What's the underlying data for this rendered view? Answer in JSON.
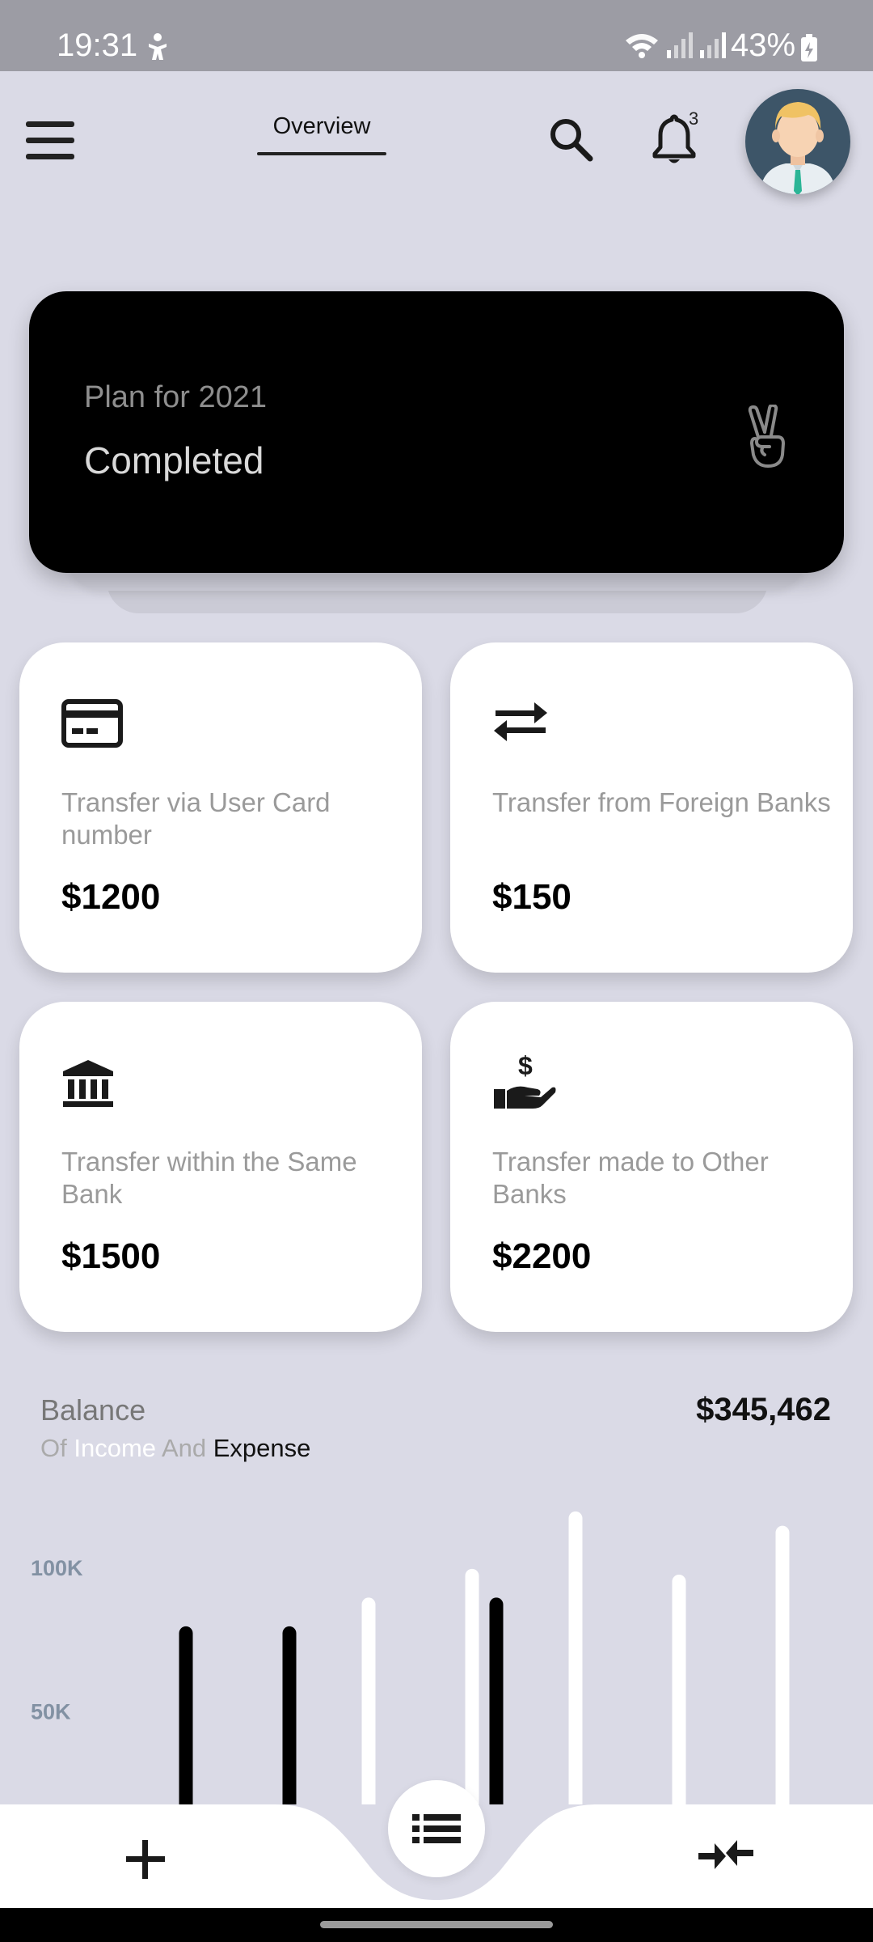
{
  "status_bar": {
    "time": "19:31",
    "battery": "43%"
  },
  "header": {
    "tab": "Overview",
    "notification_count": "3"
  },
  "plan": {
    "title": "Plan for 2021",
    "status": "Completed",
    "icon": "victory-hand-icon"
  },
  "cards": [
    {
      "icon": "credit-card-icon",
      "label": "Transfer via User Card number",
      "amount": "$1200"
    },
    {
      "icon": "exchange-arrows-icon",
      "label": "Transfer from Foreign Banks",
      "amount": "$150"
    },
    {
      "icon": "bank-building-icon",
      "label": "Transfer within the Same Bank",
      "amount": "$1500"
    },
    {
      "icon": "hand-dollar-icon",
      "label": "Transfer made to Other Banks",
      "amount": "$2200"
    }
  ],
  "balance": {
    "title": "Balance",
    "sub_of": "Of",
    "sub_income": "Income",
    "sub_and": "And",
    "sub_expense": "Expense",
    "total": "$345,462"
  },
  "chart_data": {
    "type": "bar",
    "yticks": [
      "100K",
      "50K"
    ],
    "series": [
      {
        "name": "Income",
        "color": "#ffffff",
        "values": [
          null,
          72,
          82,
          102,
          80,
          97
        ]
      },
      {
        "name": "Expense",
        "color": "#000000",
        "values": [
          62,
          62,
          null,
          72,
          null,
          null
        ]
      }
    ],
    "colors": {
      "income": "#ffffff",
      "expense": "#000000"
    }
  },
  "bottom_nav": {
    "add": "plus-icon",
    "center": "list-icon",
    "compress": "compress-arrows-icon"
  }
}
